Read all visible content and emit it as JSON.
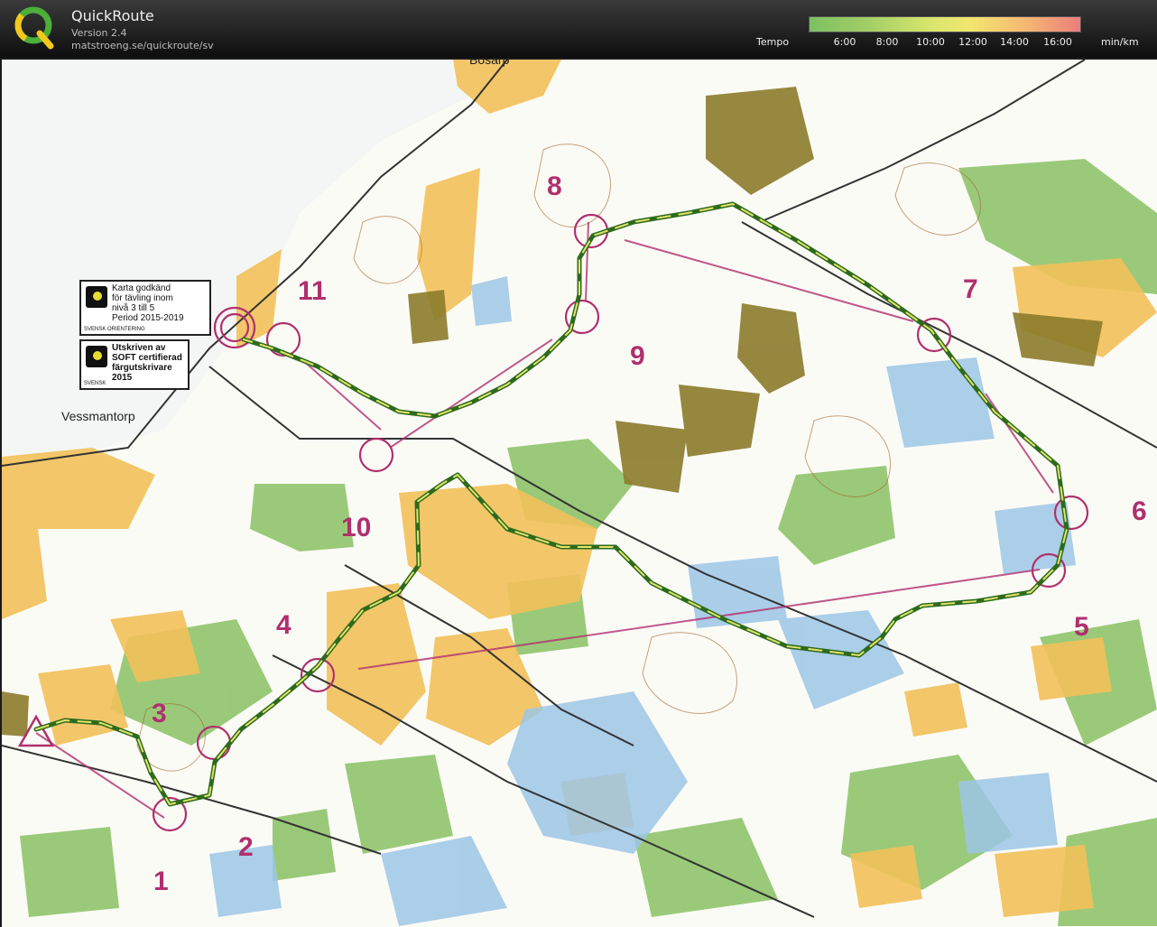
{
  "app": {
    "title": "QuickRoute",
    "version": "Version 2.4",
    "url": "matstroeng.se/quickroute/sv"
  },
  "legend": {
    "label": "Tempo",
    "ticks": [
      "6:00",
      "8:00",
      "10:00",
      "12:00",
      "14:00",
      "16:00"
    ],
    "unit": "min/km",
    "colors": {
      "fast": "#7dbf64",
      "mid": "#f2e56f",
      "slow": "#ec7d7d"
    }
  },
  "map": {
    "place_names": [
      "Bosarp",
      "Vessmantorp"
    ],
    "badge1": {
      "lines": [
        "Karta godkänd",
        "för tävling inom",
        "nivå 3 till 5",
        "Period 2015-2019"
      ],
      "small": "SVENSK ORIENTERING"
    },
    "badge2": {
      "lines": [
        "Utskriven av",
        "SOFT certifierad",
        "färgutskrivare",
        "2015"
      ],
      "small": "SVENSK"
    },
    "controls": [
      "1",
      "2",
      "3",
      "4",
      "5",
      "6",
      "7",
      "8",
      "9",
      "10",
      "11"
    ],
    "colors": {
      "course": "#b0306e",
      "route": "#2d6b1c",
      "forest": "#8fc46b",
      "open": "#f2c15a",
      "marsh": "#9cc6e6",
      "building": "#8c7b2c"
    }
  }
}
